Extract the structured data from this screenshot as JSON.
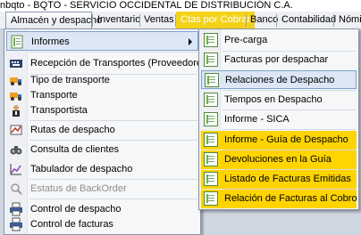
{
  "window": {
    "title": "nbqto - BQTO - SERVICIO OCCIDENTAL DE DISTRIBUCIÓN C.A."
  },
  "menubar": {
    "items": [
      {
        "label": "Almacén y despacho"
      },
      {
        "label": "Inventario"
      },
      {
        "label": "Ventas"
      },
      {
        "label": "Ctas por Cobrar"
      },
      {
        "label": "Banco"
      },
      {
        "label": "Contabilidad"
      },
      {
        "label": "Nómi"
      }
    ],
    "highlight_color": "#f5d21a"
  },
  "main_menu": {
    "items": [
      {
        "label": "Informes",
        "icon": "report-icon"
      },
      {
        "label": "Recepción de Transportes (Proveedores)",
        "icon": "keyboard-icon"
      },
      {
        "label": "Tipo de transporte",
        "icon": "truck-icon"
      },
      {
        "label": "Transporte",
        "icon": "truck-icon"
      },
      {
        "label": "Transportista",
        "icon": "driver-icon"
      },
      {
        "label": "Rutas de despacho",
        "icon": "route-icon"
      },
      {
        "label": "Consulta de clientes",
        "icon": "binoculars-icon"
      },
      {
        "label": "Tabulador de despacho",
        "icon": "chart-icon"
      },
      {
        "label": "Estatus de BackOrder",
        "icon": "magnifier-icon"
      },
      {
        "label": "Control de despacho",
        "icon": "printer-icon"
      },
      {
        "label": "Control de facturas",
        "icon": "printer-icon"
      }
    ]
  },
  "submenu": {
    "items": [
      {
        "label": "Pre-carga"
      },
      {
        "label": "Facturas por despachar"
      },
      {
        "label": "Relaciones de Despacho"
      },
      {
        "label": "Tiempos en Despacho"
      },
      {
        "label": "Informe - SICA"
      },
      {
        "label": "Informe - Guía de Despacho"
      },
      {
        "label": "Devoluciones en la Guía"
      },
      {
        "label": "Listado de Facturas Emitidas"
      },
      {
        "label": "Relación de Facturas al Cobro"
      }
    ],
    "highlight_color": "#ffd400"
  }
}
